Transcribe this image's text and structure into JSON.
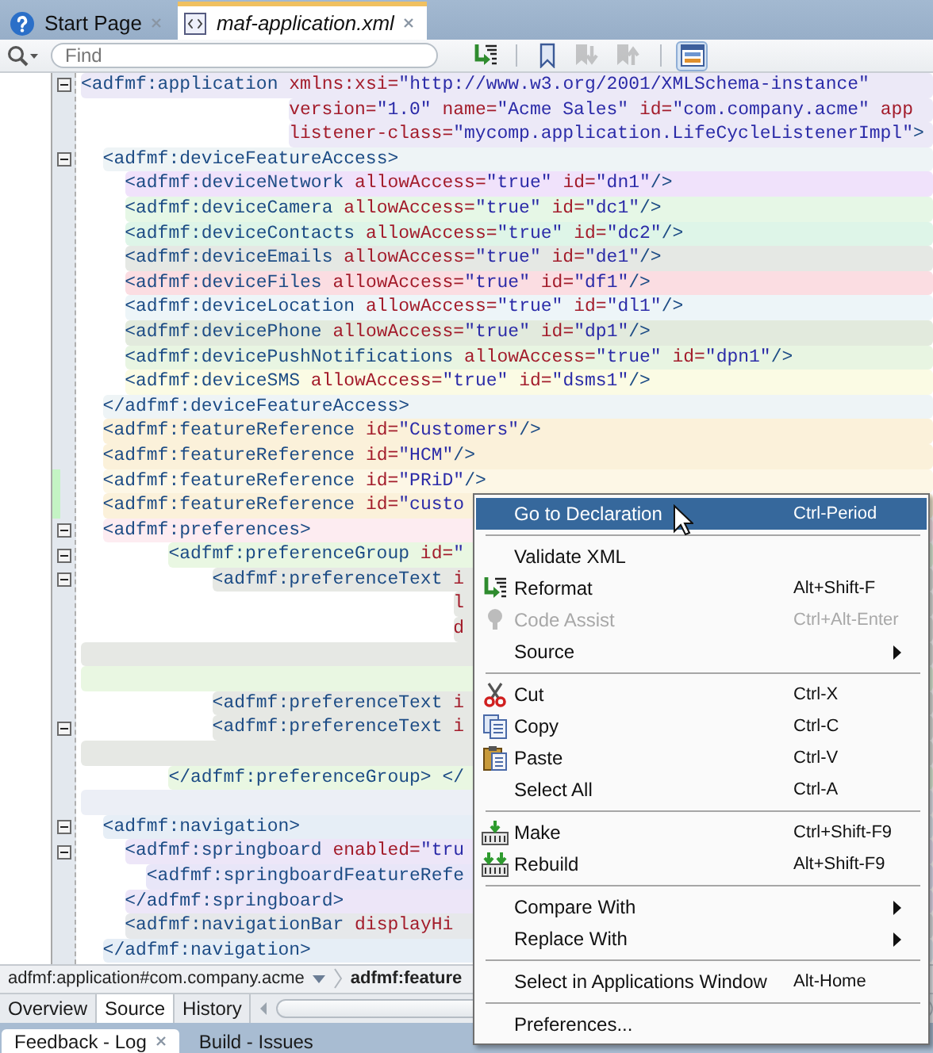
{
  "tabs": [
    {
      "label": "Start Page",
      "kind": "help",
      "selected": false
    },
    {
      "label": "maf-application.xml",
      "kind": "xml",
      "selected": true
    }
  ],
  "search": {
    "placeholder": "Find"
  },
  "toolbar_groups": [
    [
      {
        "kind": "reformat",
        "disabled": false,
        "selected": false
      }
    ],
    [
      {
        "kind": "bookmark",
        "disabled": false,
        "selected": false
      },
      {
        "kind": "next-bookmark",
        "disabled": true,
        "selected": false
      },
      {
        "kind": "previous-bookmark",
        "disabled": true,
        "selected": false
      }
    ],
    [
      {
        "kind": "split",
        "disabled": false,
        "selected": true
      }
    ]
  ],
  "lines": [
    {
      "text": "<adfmf:application xmlns:xsi=\"http://www.w3.org/2001/XMLSchema-instance\"",
      "color": "#ece9f7",
      "fold": true,
      "changed": false
    },
    {
      "text": "                   version=\"1.0\" name=\"Acme Sales\" id=\"com.company.acme\" app",
      "color": "#ece9f7",
      "fold": false,
      "changed": false
    },
    {
      "text": "                   listener-class=\"mycomp.application.LifeCycleListenerImpl\">",
      "color": "#ece9f7",
      "fold": false,
      "changed": false
    },
    {
      "text": "  <adfmf:deviceFeatureAccess>",
      "color": "#eef4f6",
      "fold": true,
      "changed": false
    },
    {
      "text": "    <adfmf:deviceNetwork allowAccess=\"true\" id=\"dn1\"/>",
      "color": "#f0e2fb",
      "fold": false,
      "changed": false
    },
    {
      "text": "    <adfmf:deviceCamera allowAccess=\"true\" id=\"dc1\"/>",
      "color": "#e6f7e6",
      "fold": false,
      "changed": false
    },
    {
      "text": "    <adfmf:deviceContacts allowAccess=\"true\" id=\"dc2\"/>",
      "color": "#def5e8",
      "fold": false,
      "changed": false
    },
    {
      "text": "    <adfmf:deviceEmails allowAccess=\"true\" id=\"de1\"/>",
      "color": "#e5e8e4",
      "fold": false,
      "changed": false
    },
    {
      "text": "    <adfmf:deviceFiles allowAccess=\"true\" id=\"df1\"/>",
      "color": "#fbdde2",
      "fold": false,
      "changed": false
    },
    {
      "text": "    <adfmf:deviceLocation allowAccess=\"true\" id=\"dl1\"/>",
      "color": "#edf5f8",
      "fold": false,
      "changed": false
    },
    {
      "text": "    <adfmf:devicePhone allowAccess=\"true\" id=\"dp1\"/>",
      "color": "#e2eadd",
      "fold": false,
      "changed": false
    },
    {
      "text": "    <adfmf:devicePushNotifications allowAccess=\"true\" id=\"dpn1\"/>",
      "color": "#e8f5e2",
      "fold": false,
      "changed": false
    },
    {
      "text": "    <adfmf:deviceSMS allowAccess=\"true\" id=\"dsms1\"/>",
      "color": "#fbfbe4",
      "fold": false,
      "changed": false
    },
    {
      "text": "  </adfmf:deviceFeatureAccess>",
      "color": "#eef4f6",
      "fold": false,
      "changed": false
    },
    {
      "text": "  <adfmf:featureReference id=\"Customers\"/>",
      "color": "#fbf1da",
      "fold": false,
      "changed": false
    },
    {
      "text": "  <adfmf:featureReference id=\"HCM\"/>",
      "color": "#fbf1da",
      "fold": false,
      "changed": false
    },
    {
      "text": "  <adfmf:featureReference id=\"PRiD\"/>",
      "color": "#fdf7e6",
      "fold": false,
      "changed": true
    },
    {
      "text": "  <adfmf:featureReference id=\"custo",
      "color": "#fbf1da",
      "fold": false,
      "changed": true
    },
    {
      "text": "  <adfmf:preferences>",
      "color": "#fdecf1",
      "fold": true,
      "changed": false
    },
    {
      "text": "        <adfmf:preferenceGroup id=\"",
      "color": "#e9f7e2",
      "fold": true,
      "changed": false
    },
    {
      "text": "            <adfmf:preferenceText i",
      "color": "#e6e8e4",
      "fold": true,
      "changed": false
    },
    {
      "text": "                                  l",
      "color": "#e6e8e4",
      "fold": false,
      "changed": false
    },
    {
      "text": "                                  d",
      "color": "#e6e8e4",
      "fold": false,
      "changed": false
    },
    {
      "color": "#e6e8e4",
      "fold": false,
      "changed": false
    },
    {
      "color": "#e9f7e2",
      "fold": false,
      "changed": false
    },
    {
      "text": "            <adfmf:preferenceText i",
      "color": "#e6e8e4",
      "fold": false,
      "changed": false
    },
    {
      "text": "            <adfmf:preferenceText i",
      "color": "#e6e8e4",
      "fold": true,
      "changed": false
    },
    {
      "color": "#e6e8e4",
      "fold": false,
      "changed": false
    },
    {
      "text": "        </adfmf:preferenceGroup> </",
      "color": "#e9f7e2",
      "fold": false,
      "changed": false
    },
    {
      "color": "#eceff6",
      "fold": false,
      "changed": false
    },
    {
      "text": "  <adfmf:navigation>",
      "color": "#e6eef6",
      "fold": true,
      "changed": false
    },
    {
      "text": "    <adfmf:springboard enabled=\"tru",
      "color": "#ede6f8",
      "fold": true,
      "changed": false
    },
    {
      "text": "      <adfmf:springboardFeatureRefe",
      "color": "#e8e6f8",
      "fold": false,
      "changed": false
    },
    {
      "text": "    </adfmf:springboard>",
      "color": "#ede6f8",
      "fold": false,
      "changed": false
    },
    {
      "text": "    <adfmf:navigationBar displayHi",
      "color": "#e6e8ea",
      "fold": false,
      "changed": false
    },
    {
      "text": "  </adfmf:navigation>",
      "color": "#e6eef6",
      "fold": false,
      "changed": false
    }
  ],
  "breadcrumb": [
    {
      "label": "adfmf:application#com.company.acme",
      "current": false
    },
    {
      "label": "adfmf:feature",
      "current": true
    }
  ],
  "view_tabs": [
    {
      "label": "Overview",
      "selected": false
    },
    {
      "label": "Source",
      "selected": true
    },
    {
      "label": "History",
      "selected": false
    }
  ],
  "panel_tabs": [
    {
      "label": "Feedback - Log",
      "selected": true
    },
    {
      "label": "Build - Issues",
      "selected": false
    }
  ],
  "context_menu": [
    {
      "kind": "item",
      "label": "Go to Declaration",
      "shortcut": "Ctrl-Period",
      "selected": true,
      "disabled": false
    },
    {
      "kind": "separator"
    },
    {
      "kind": "item",
      "label": "Validate XML",
      "selected": false,
      "disabled": false
    },
    {
      "kind": "item",
      "label": "Reformat",
      "shortcut": "Alt+Shift-F",
      "selected": false,
      "disabled": false
    },
    {
      "kind": "item",
      "label": "Code Assist",
      "shortcut": "Ctrl+Alt-Enter",
      "selected": false,
      "disabled": true
    },
    {
      "kind": "submenu",
      "label": "Source",
      "selected": false,
      "disabled": false
    },
    {
      "kind": "separator"
    },
    {
      "kind": "item",
      "label": "Cut",
      "shortcut": "Ctrl-X",
      "selected": false,
      "disabled": false
    },
    {
      "kind": "item",
      "label": "Copy",
      "shortcut": "Ctrl-C",
      "selected": false,
      "disabled": false
    },
    {
      "kind": "item",
      "label": "Paste",
      "shortcut": "Ctrl-V",
      "selected": false,
      "disabled": false
    },
    {
      "kind": "item",
      "label": "Select All",
      "shortcut": "Ctrl-A",
      "selected": false,
      "disabled": false
    },
    {
      "kind": "separator"
    },
    {
      "kind": "item",
      "label": "Make",
      "shortcut": "Ctrl+Shift-F9",
      "selected": false,
      "disabled": false
    },
    {
      "kind": "item",
      "label": "Rebuild",
      "shortcut": "Alt+Shift-F9",
      "selected": false,
      "disabled": false
    },
    {
      "kind": "separator"
    },
    {
      "kind": "submenu",
      "label": "Compare With",
      "selected": false,
      "disabled": false
    },
    {
      "kind": "submenu",
      "label": "Replace With",
      "selected": false,
      "disabled": false
    },
    {
      "kind": "separator"
    },
    {
      "kind": "item",
      "label": "Select in Applications Window",
      "shortcut": "Alt-Home",
      "selected": false,
      "disabled": false
    },
    {
      "kind": "separator"
    },
    {
      "kind": "item",
      "label": "Preferences...",
      "selected": false,
      "disabled": false
    }
  ]
}
